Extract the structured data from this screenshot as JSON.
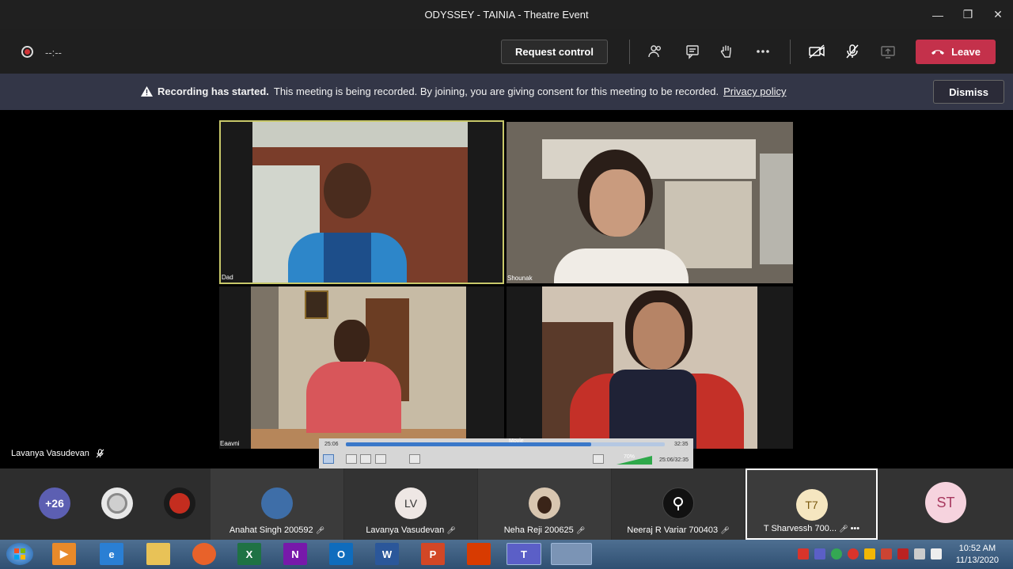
{
  "window": {
    "title": "ODYSSEY - TAINIA - Theatre Event",
    "minimize": "—",
    "maximize": "❐",
    "close": "✕"
  },
  "toolbar": {
    "timer": "--:--",
    "request_control": "Request control",
    "leave": "Leave"
  },
  "banner": {
    "bold": "Recording has started.",
    "text": "This meeting is being recorded. By joining, you are giving consent for this meeting to be recorded.",
    "link": "Privacy policy",
    "dismiss": "Dismiss"
  },
  "video_tiles": [
    {
      "label": "Dad"
    },
    {
      "label": "Shounak"
    },
    {
      "label": "Eaavni"
    },
    {
      "label": ""
    }
  ],
  "self_view": {
    "name": "Lavanya Vasudevan"
  },
  "player": {
    "elapsed": "25:06",
    "total": "32:35",
    "title": "Movie",
    "progress": 0.77,
    "volume": "70%",
    "position": "25:06/32:35"
  },
  "participants": {
    "overflow": "+26",
    "list": [
      {
        "name": "Anahat Singh 200592",
        "initials": "",
        "type": "photo"
      },
      {
        "name": "Lavanya Vasudevan",
        "initials": "LV",
        "type": "initials"
      },
      {
        "name": "Neha Reji 200625",
        "initials": "",
        "type": "photo"
      },
      {
        "name": "Neeraj R Variar 700403",
        "initials": "",
        "type": "icon"
      },
      {
        "name": "T Sharvessh 700...",
        "initials": "T7",
        "type": "initials"
      },
      {
        "name": "",
        "initials": "ST",
        "type": "initials"
      }
    ]
  },
  "taskbar": {
    "apps": [
      "X",
      "N",
      "O",
      "W",
      "P",
      "T"
    ],
    "time": "10:52 AM",
    "date": "11/13/2020"
  },
  "colors": {
    "leave": "#c4314b",
    "banner": "#333647",
    "accent": "#6264a7"
  }
}
